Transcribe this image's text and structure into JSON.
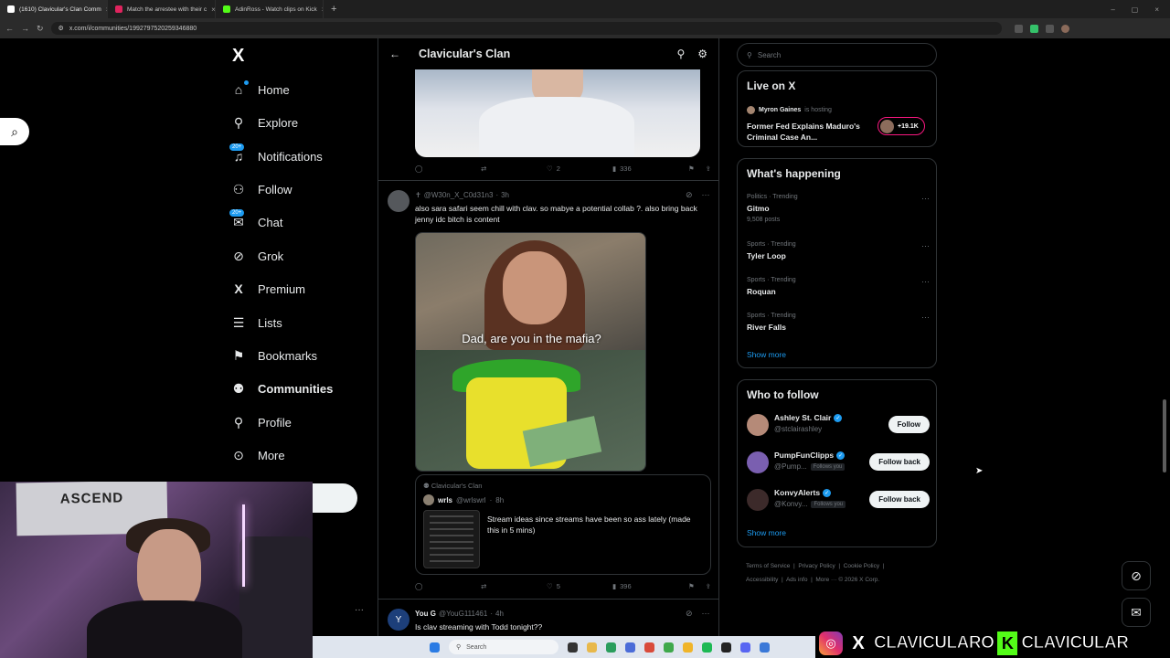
{
  "browser": {
    "tabs": [
      {
        "label": "(1610) Clavicular's Clan Comm",
        "favicon_color": "#ffffff",
        "active": true
      },
      {
        "label": "Match the arrestee with their c",
        "favicon_color": "#e0245e",
        "active": false
      },
      {
        "label": "AdinRoss - Watch clips on Kick",
        "favicon_color": "#53fc18",
        "active": false
      }
    ],
    "url": "x.com/i/communities/1992797520259346880"
  },
  "sidebar": {
    "logo": "X",
    "items": [
      {
        "label": "Home",
        "icon": "home-icon",
        "glyph": "⌂",
        "badge": ""
      },
      {
        "label": "Explore",
        "icon": "search-icon",
        "glyph": "⚲",
        "badge": ""
      },
      {
        "label": "Notifications",
        "icon": "bell-icon",
        "glyph": "🔔",
        "badge": "20+"
      },
      {
        "label": "Follow",
        "icon": "person-add-icon",
        "glyph": "👤",
        "badge": ""
      },
      {
        "label": "Chat",
        "icon": "mail-icon",
        "glyph": "✉",
        "badge": "20+"
      },
      {
        "label": "Grok",
        "icon": "grok-icon",
        "glyph": "⊘",
        "badge": ""
      },
      {
        "label": "Premium",
        "icon": "x-premium-icon",
        "glyph": "X",
        "badge": ""
      },
      {
        "label": "Lists",
        "icon": "list-icon",
        "glyph": "☰",
        "badge": ""
      },
      {
        "label": "Bookmarks",
        "icon": "bookmark-icon",
        "glyph": "🔖",
        "badge": ""
      },
      {
        "label": "Communities",
        "icon": "communities-icon",
        "glyph": "👥",
        "badge": ""
      },
      {
        "label": "Profile",
        "icon": "profile-icon",
        "glyph": "👤",
        "badge": ""
      },
      {
        "label": "More",
        "icon": "more-circle-icon",
        "glyph": "⊙",
        "badge": ""
      }
    ]
  },
  "main": {
    "title": "Clavicular's Clan",
    "post1": {
      "likes": "2",
      "views": "336"
    },
    "post2": {
      "handle": "@W30n_X_C0d31n3",
      "time": "3h",
      "text": "also sara safari seem chill with clav. so mabye a potential collab ?. also bring back jenny idc bitch is content",
      "meme_caption": "Dad, are you in the mafia?",
      "quote": {
        "community": "Clavicular's Clan",
        "name": "wrls",
        "handle": "@wrlswrl",
        "time": "8h",
        "text": "Stream ideas since streams have been so ass lately (made this in 5 mins)"
      },
      "likes": "5",
      "views": "396"
    },
    "post3": {
      "name": "You G",
      "handle": "@YouG111461",
      "time": "4h",
      "text": "Is clav streaming with Todd tonight??",
      "avatar_letter": "Y"
    }
  },
  "right": {
    "search_placeholder": "Search",
    "live": {
      "title": "Live on X",
      "host": "Myron Gaines",
      "host_suffix": "is hosting",
      "space_title": "Former Fed Explains Maduro's Criminal Case An...",
      "listeners": "+19.1K"
    },
    "happening": {
      "title": "What's happening",
      "trends": [
        {
          "meta": "Politics · Trending",
          "name": "Gitmo",
          "count": "9,508 posts"
        },
        {
          "meta": "Sports · Trending",
          "name": "Tyler Loop",
          "count": ""
        },
        {
          "meta": "Sports · Trending",
          "name": "Roquan",
          "count": ""
        },
        {
          "meta": "Sports · Trending",
          "name": "River Falls",
          "count": ""
        }
      ],
      "show_more": "Show more"
    },
    "who_to_follow": {
      "title": "Who to follow",
      "accounts": [
        {
          "name": "Ashley St. Clair",
          "handle": "@stclairashley",
          "follows_you": "",
          "button": "Follow",
          "avatar_color": "#b58a78"
        },
        {
          "name": "PumpFunClipps",
          "handle": "@Pump...",
          "follows_you": "Follows you",
          "button": "Follow back",
          "avatar_color": "#7a5fb0"
        },
        {
          "name": "KonvyAlerts",
          "handle": "@Konvy...",
          "follows_you": "Follows you",
          "button": "Follow back",
          "avatar_color": "#3c2a2a"
        }
      ],
      "show_more": "Show more"
    },
    "footer": [
      "Terms of Service",
      "Privacy Policy",
      "Cookie Policy",
      "Accessibility",
      "Ads info",
      "More ···",
      "© 2026 X Corp."
    ]
  },
  "stream_overlay": {
    "poster_text": "ASCEND",
    "handle_text": "CLAVICULARO",
    "kick_text": "CLAVICULAR",
    "kick_letter": "K"
  },
  "taskbar": {
    "search_label": "Search"
  }
}
